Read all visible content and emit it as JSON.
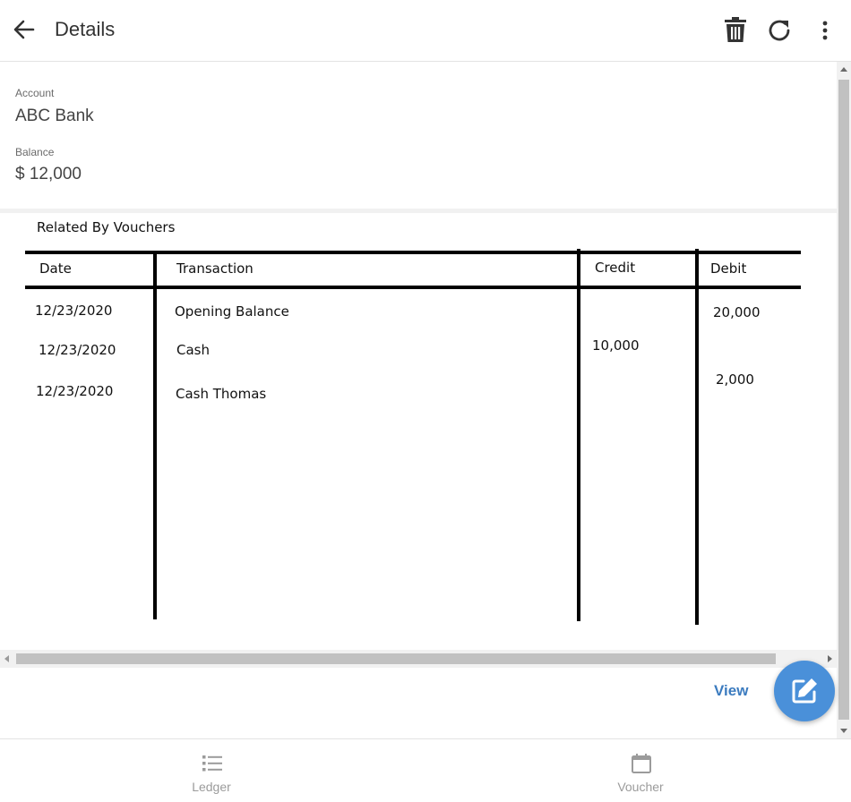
{
  "app_bar": {
    "title": "Details",
    "back_icon": "arrow-left-icon",
    "actions": [
      {
        "name": "delete",
        "icon": "trash-icon"
      },
      {
        "name": "refresh",
        "icon": "refresh-icon"
      },
      {
        "name": "more",
        "icon": "more-vertical-icon"
      }
    ]
  },
  "account": {
    "label": "Account",
    "value": "ABC Bank"
  },
  "balance": {
    "label": "Balance",
    "value": "$ 12,000"
  },
  "vouchers": {
    "heading": "Related By Vouchers",
    "columns": [
      "Date",
      "Transaction",
      "Credit",
      "Debit"
    ],
    "rows": [
      {
        "date": "12/23/2020",
        "transaction": "Opening Balance",
        "credit": "",
        "debit": "20,000"
      },
      {
        "date": "12/23/2020",
        "transaction": "Cash",
        "credit": "10,000",
        "debit": ""
      },
      {
        "date": "12/23/2020",
        "transaction": "Cash Thomas",
        "credit": "",
        "debit": "2,000"
      }
    ]
  },
  "actions": {
    "view_label": "View",
    "fab_icon": "edit-icon"
  },
  "bottom_nav": [
    {
      "label": "Ledger",
      "icon": "list-icon"
    },
    {
      "label": "Voucher",
      "icon": "calendar-icon"
    }
  ],
  "colors": {
    "accent": "#4a90d9",
    "link": "#3b7bbf",
    "nav_inactive": "#9b9b9b"
  }
}
